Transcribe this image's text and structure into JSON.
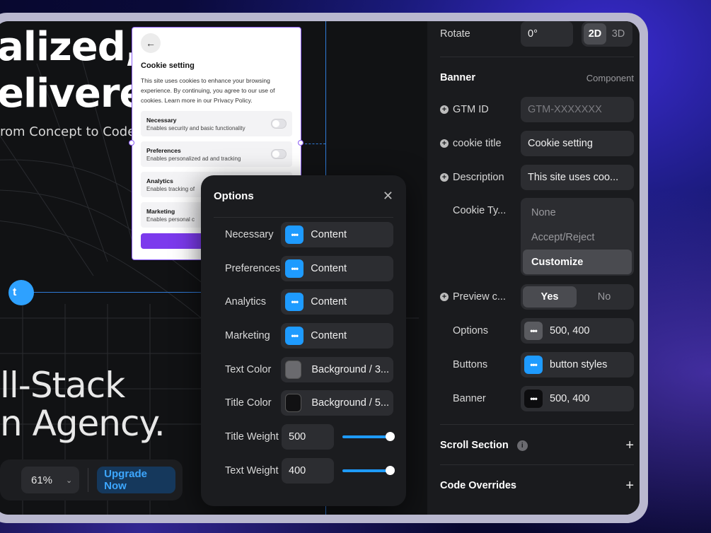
{
  "canvas": {
    "hero_line1": "alized,",
    "hero_line2": "elivere",
    "hero_sub": "rom Concept to Code",
    "hero_line3": "ll-Stack",
    "hero_line4": "n Agency.",
    "pill_text": "t"
  },
  "toolbar": {
    "zoom_value": "61%",
    "upgrade_label": "Upgrade Now"
  },
  "cookie_card": {
    "title": "Cookie setting",
    "body": "This site uses cookies to enhance your browsing experience. By continuing, you agree to our use of cookies. Learn more in our Privacy Policy.",
    "rows": [
      {
        "title": "Necessary",
        "desc": "Enables security and basic functionality"
      },
      {
        "title": "Preferences",
        "desc": "Enables personalized ad and tracking"
      },
      {
        "title": "Analytics",
        "desc": "Enables tracking of"
      },
      {
        "title": "Marketing",
        "desc": "Enables personal c"
      }
    ]
  },
  "options": {
    "title": "Options",
    "rows": [
      {
        "label": "Necessary",
        "value": "Content"
      },
      {
        "label": "Preferences",
        "value": "Content"
      },
      {
        "label": "Analytics",
        "value": "Content"
      },
      {
        "label": "Marketing",
        "value": "Content"
      }
    ],
    "text_color": {
      "label": "Text Color",
      "value": "Background / 3...",
      "swatch": "#6a6a6e"
    },
    "title_color": {
      "label": "Title Color",
      "value": "Background / 5...",
      "swatch": "#111113"
    },
    "title_weight": {
      "label": "Title Weight",
      "value": "500"
    },
    "text_weight": {
      "label": "Text Weight",
      "value": "400"
    }
  },
  "panel": {
    "rotate": {
      "label": "Rotate",
      "value": "0°",
      "seg": [
        "2D",
        "3D"
      ],
      "active": "2D"
    },
    "banner_header": {
      "title": "Banner",
      "tag": "Component"
    },
    "gtm": {
      "label": "GTM ID",
      "placeholder": "GTM-XXXXXXX"
    },
    "cookie_title": {
      "label": "cookie title",
      "value": "Cookie setting"
    },
    "description": {
      "label": "Description",
      "value": "This site uses coo..."
    },
    "cookie_type": {
      "label": "Cookie Ty...",
      "options": [
        "None",
        "Accept/Reject",
        "Customize"
      ],
      "selected": "Customize"
    },
    "preview": {
      "label": "Preview c...",
      "seg": [
        "Yes",
        "No"
      ],
      "active": "Yes"
    },
    "options_row": {
      "label": "Options",
      "value": "500, 400"
    },
    "buttons_row": {
      "label": "Buttons",
      "value": "button styles"
    },
    "banner_row": {
      "label": "Banner",
      "value": "500, 400"
    },
    "scroll_section": "Scroll Section",
    "code_overrides": "Code Overrides"
  },
  "colors": {
    "accent_blue": "#1e9bff",
    "purple": "#7c3aed",
    "panel_bg": "#1a1b1e"
  }
}
